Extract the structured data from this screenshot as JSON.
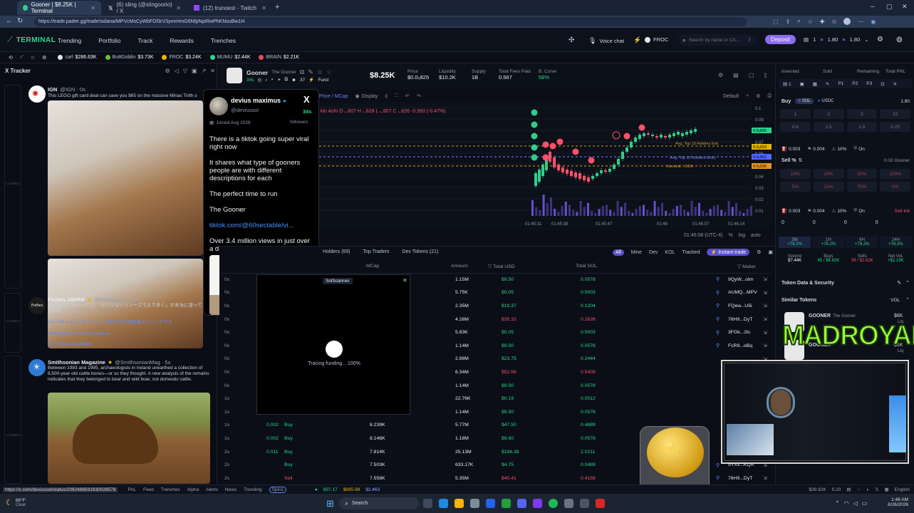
{
  "browser": {
    "tabs": [
      {
        "label": "Gooner | $8.25K | Terminal",
        "active": true
      },
      {
        "label": "(6) sling (@slingoorio) / X",
        "active": false
      },
      {
        "label": "(12) trunoest - Twitch",
        "active": false
      }
    ],
    "url": "https://trade.padre.gg/trade/solana/MPVcMsCyWbFDf3rV3yonHmG6NfpNpiRwPhKNsuBw1H"
  },
  "app": {
    "logo": "TERMINAL",
    "nav": [
      "Trending",
      "Portfolio",
      "Track",
      "Rewards",
      "Trenches"
    ],
    "voice_chat": "Voice chat",
    "froc": "FROC",
    "search_placeholder": "Search by name or CA...",
    "search_key": "/",
    "deposit": "Deposit",
    "wallet_count": "1",
    "wallet_bal1": "1.80",
    "wallet_bal2": "1.80"
  },
  "ticker": [
    {
      "name": "carl",
      "value": "$286.63K"
    },
    {
      "name": "ButtGoblin",
      "value": "$3.73K"
    },
    {
      "name": "FROC",
      "value": "$3.24K"
    },
    {
      "name": "MUMU",
      "value": "$2.44K"
    },
    {
      "name": "BRAIN",
      "value": "$2.21K"
    }
  ],
  "tracker": {
    "title": "X Tracker",
    "tweets": [
      {
        "name": "IGN",
        "handle": "@IGN · 0s",
        "body": "This LEGO gift card deal can save you $65 on the massive Minas Tirith s"
      },
      {
        "name": "Forbes JAPAN",
        "handle": "@forbesjapan · 3s",
        "body": "生産性のパラドックス：「より少ないリソースでより多く」が本当に習って",
        "body2": "るもの",
        "tags": "#リーダー #リーダーシップ #燃え尽き症候群 #バーンアウト",
        "link": "forbesjapan.com/articles/detai...",
        "translate": "Show translation"
      },
      {
        "name": "Smithsonian Magazine",
        "handle": "@SmithsonianMag · 5s",
        "body": "Between 1983 and 1995, archaeologists in Ireland unearthed a collection of 8,500-year-old cattle bones—or so they thought. A new analysis of the remains indicates that they belonged to bear and wild boar, not domestic cattle."
      }
    ],
    "launch": "LAUNCH"
  },
  "popup": {
    "name": "devius maximus",
    "handle": "@deviussol",
    "time": "34s",
    "joined": "Joined Aug 2026",
    "followers": "followers",
    "lines": [
      "There is a tiktok going super viral right now",
      "It shares what type of gooners people are with different descriptions for each",
      "The perfect time to run",
      "The Gooner"
    ],
    "link": "tiktok.com/@60sectable/vi...",
    "footer": "Over 3.4 million views in just over a day"
  },
  "coin": {
    "name": "Gooner",
    "sub": "The Gooner",
    "age": "34s",
    "holders_count": "37",
    "fund": "Fund",
    "mcap": "$8.25K",
    "stats": [
      {
        "label": "Price",
        "value": "$0.0₅825"
      },
      {
        "label": "Liquidity",
        "value": "$10.2K"
      },
      {
        "label": "Supply",
        "value": "1B"
      },
      {
        "label": "Total Fees Paid",
        "value": "0.567"
      },
      {
        "label": "B. Curve",
        "value": "58%"
      }
    ]
  },
  "chart": {
    "toolbar": {
      "price_mcap": "Price / MCap",
      "display": "Display",
      "default": "Default"
    },
    "ohlc": "kin Ashi  O ₀.807  H ₀.828  L ₀.807  C ₀.826  -0.393 (-0.47%)",
    "x_ticks": [
      "01:45:31",
      "01:45:38",
      "01:45:47",
      "01:46",
      "01:46:07",
      "01:46:14"
    ],
    "y_ticks": [
      "0.1",
      "0.09",
      "0.08",
      "0.07",
      "0.06",
      "0.05",
      "0.04",
      "0.03",
      "0.02",
      "0.01"
    ],
    "lines": {
      "top10_exit": "Avg. Top 10 Holders Exit",
      "top10_entry": "Avg. Top 10 Holders Entry",
      "trunoest": "trunoest · 3.5%"
    },
    "price_tags": [
      "0.0₅826",
      "0.0₅693",
      "0.0₅652",
      "0.0₅536"
    ],
    "clock": "01:46:08 (UTC-4)",
    "scale": [
      "%",
      "log",
      "auto"
    ]
  },
  "table": {
    "tabs": [
      "Holders (69)",
      "Top Traders",
      "Dev Tokens (21)"
    ],
    "filters": [
      "All",
      "Mine",
      "Dev",
      "KOL",
      "Tracked",
      "Instant trade"
    ],
    "headers": [
      "MCap",
      "Amount",
      "Total USD",
      "Total SOL",
      "Maker"
    ],
    "rows": [
      {
        "age": "",
        "sol": "",
        "type": "",
        "mcap": "",
        "amount": "1.15M",
        "usd": "$9.50",
        "tsol": "0.0578",
        "maker": "9QyW...otm",
        "side": "buy"
      },
      {
        "age": "",
        "sol": "",
        "type": "",
        "mcap": "",
        "amount": "5.75K",
        "usd": "$0.05",
        "tsol": "0.0003",
        "maker": "AUMQ...MPV",
        "side": "buy"
      },
      {
        "age": "",
        "sol": "",
        "type": "",
        "mcap": "",
        "amount": "2.35M",
        "usd": "$19.37",
        "tsol": "0.1204",
        "maker": "FQew...U5i",
        "side": "buy"
      },
      {
        "age": "",
        "sol": "",
        "type": "",
        "mcap": "",
        "amount": "4.28M",
        "usd": "$35.32",
        "tsol": "0.2626",
        "maker": "76H9...DyT",
        "side": "sell"
      },
      {
        "age": "",
        "sol": "",
        "type": "",
        "mcap": "",
        "amount": "5.83K",
        "usd": "$0.05",
        "tsol": "0.0003",
        "maker": "3FGk...2tc",
        "side": "buy"
      },
      {
        "age": "",
        "sol": "",
        "type": "",
        "mcap": "",
        "amount": "1.14M",
        "usd": "$9.50",
        "tsol": "0.0578",
        "maker": "FcR9...oBq",
        "side": "buy"
      },
      {
        "age": "",
        "sol": "",
        "type": "",
        "mcap": "",
        "amount": "2.88M",
        "usd": "$23.75",
        "tsol": "0.2444",
        "maker": "",
        "side": "buy"
      },
      {
        "age": "",
        "sol": "",
        "type": "",
        "mcap": "",
        "amount": "6.34M",
        "usd": "$52.56",
        "tsol": "0.5409",
        "maker": "",
        "side": "sell"
      },
      {
        "age": "",
        "sol": "",
        "type": "",
        "mcap": "",
        "amount": "1.14M",
        "usd": "$9.50",
        "tsol": "0.0578",
        "maker": "",
        "side": "buy"
      },
      {
        "age": "",
        "sol": "",
        "type": "",
        "mcap": "",
        "amount": "22.76K",
        "usd": "$0.19",
        "tsol": "0.0012",
        "maker": "",
        "side": "buy"
      },
      {
        "age": "",
        "sol": "",
        "type": "",
        "mcap": "",
        "amount": "1.14M",
        "usd": "$9.50",
        "tsol": "0.0578",
        "maker": "",
        "side": "buy"
      },
      {
        "age": "1s",
        "sol": "0.002",
        "type": "Buy",
        "mcap": "8.239K",
        "amount": "5.77M",
        "usd": "$47.50",
        "tsol": "0.4889",
        "maker": "",
        "side": "buy"
      },
      {
        "age": "1s",
        "sol": "0.002",
        "type": "Buy",
        "mcap": "8.146K",
        "amount": "1.18M",
        "usd": "$9.60",
        "tsol": "0.0578",
        "maker": "",
        "side": "buy"
      },
      {
        "age": "2s",
        "sol": "0.011",
        "type": "Buy",
        "mcap": "7.814K",
        "amount": "25.13M",
        "usd": "$196.38",
        "tsol": "2.0211",
        "maker": "",
        "side": "buy"
      },
      {
        "age": "2s",
        "sol": "",
        "type": "Buy",
        "mcap": "7.503K",
        "amount": "633.17K",
        "usd": "$4.75",
        "tsol": "0.0489",
        "maker": "5YXx...KQA",
        "side": "buy"
      },
      {
        "age": "2s",
        "sol": "",
        "type": "Sell",
        "mcap": "7.558K",
        "amount": "5.35M",
        "usd": "$40.41",
        "tsol": "0.4159",
        "maker": "76H9...DyT",
        "side": "sell"
      }
    ],
    "age_col": [
      "0s",
      "0s",
      "0s",
      "0s",
      "0s",
      "0s",
      "0s",
      "0s",
      "0s",
      "1s",
      "1s"
    ]
  },
  "solscanner": {
    "title": "SolScanner",
    "status": "Tracing funding... 100%"
  },
  "right": {
    "tabs": [
      "Invested",
      "Sold",
      "Remaining",
      "Total PNL"
    ],
    "presets": [
      "P1",
      "P2",
      "P3"
    ],
    "buy": "Buy",
    "sol": "SOL",
    "usdc": "USDC",
    "balance": "1.80",
    "buy_amounts": [
      "1",
      "2",
      "5",
      "10",
      "0.6",
      "2.5",
      "1.5",
      "0.25"
    ],
    "buy_row": [
      "0.003",
      "0.004",
      "10%",
      "On"
    ],
    "sell": "Sell %",
    "sell_token": "0.00 Gooner",
    "sell_amounts": [
      "10%",
      "20%",
      "50%",
      "100%",
      "5%",
      "15%",
      "75%",
      "0%"
    ],
    "sell_row": [
      "0.003",
      "0.004",
      "10%",
      "On"
    ],
    "sell_init": "Sell Init",
    "zeros": [
      "0",
      "0",
      "0",
      "0"
    ],
    "periods": [
      {
        "label": "5M",
        "value": "+78.2%"
      },
      {
        "label": "1H",
        "value": "+78.2%"
      },
      {
        "label": "6H",
        "value": "+78.2%"
      },
      {
        "label": "24H",
        "value": "+78.2%"
      }
    ],
    "volume": {
      "label": "Volume",
      "value": "$7.44K"
    },
    "buys": {
      "label": "Buys",
      "value": "45 / $4.82K"
    },
    "sells": {
      "label": "Sells",
      "value": "39 / $2.62K"
    },
    "net": {
      "label": "Net Vol.",
      "value": "+$2.19K"
    },
    "security": "Token Data & Security",
    "similar": "Similar Tokens",
    "vol_sort": "VOL",
    "similar_items": [
      {
        "name": "GOONER",
        "sub": "The Gooner",
        "mcap": "$6K",
        "liq": "Liq"
      },
      {
        "name": "GOONER",
        "sub": "",
        "mcap": "$1K",
        "liq": "Liq"
      }
    ]
  },
  "overlay": {
    "brand": "MADROYALS"
  },
  "statusbar": {
    "link": "https://x.com/deviussol/status/2092488591830028578",
    "items": [
      "PnL",
      "Feed",
      "Trenches",
      "Alpha",
      "Alerts",
      "News",
      "Trending",
      "Spins"
    ],
    "bal1": "$97.17",
    "bal2": "$695.98",
    "bal3": "$2,463",
    "right1": "$39.92K",
    "right2": "0.20",
    "lang": "English"
  },
  "taskbar": {
    "weather_temp": "66°F",
    "weather_desc": "Clear",
    "search": "Search",
    "time": "1:48 AM",
    "date": "8/26/2026"
  }
}
